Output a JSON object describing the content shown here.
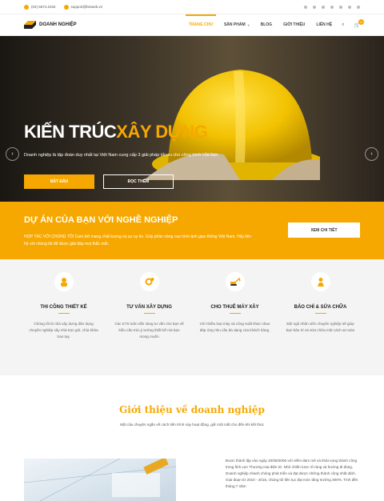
{
  "topbar": {
    "phone": "(04) 6674.2332",
    "email": "support@bizweb.vn",
    "social_icons": [
      "facebook-icon",
      "twitter-icon",
      "google-plus-icon",
      "pinterest-icon",
      "instagram-icon",
      "youtube-icon",
      "skype-icon"
    ]
  },
  "header": {
    "logo_text": "DOANH NGHIỆP",
    "nav": [
      "TRANG CHỦ",
      "SẢN PHẨM",
      "BLOG",
      "GIỚI THIỆU",
      "LIÊN HỆ"
    ],
    "active_nav": "TRANG CHỦ",
    "cart_count": "0"
  },
  "hero": {
    "title_part1": "KIẾN TRÚC",
    "title_part2": "XÂY DỰNG",
    "subtitle": "Doanh nghiệp là tập đoàn duy nhất tại Việt Nam cung cấp 3 giải pháp tối ưu cho công trình của bạn",
    "btn_primary": "BẮT ĐẦU",
    "btn_secondary": "ĐỌC THÊM"
  },
  "cta": {
    "title": "DỰ ÁN CỦA BẠN VỚI NGHỀ NGHIỆP",
    "text": "HỢP TÁC VỚI CHÚNG TÔI Cam kết mang chất lượng và sự uy tín. Góp phần nâng cao hình ảnh giao thông Việt Nam. Hãy liên hệ với chúng tôi để được giải đáp mọi thắc mắc",
    "button": "XEM CHI TIẾT"
  },
  "services": [
    {
      "icon": "construction-worker-icon",
      "title": "THI CÔNG THIẾT KẾ",
      "desc": "Chúng tôi là nhà xây dựng dân dụng chuyên nghiệp xây nhà trọn gói, chìa khóa trao tay."
    },
    {
      "icon": "gears-icon",
      "title": "TƯ VẤN XÂY DỰNG",
      "desc": "Các KTS luôn sẵn sàng tư vấn cho bạn về kiểu cấu trúc,ý tưởng thiết kế mà bạn mong muốn"
    },
    {
      "icon": "excavator-icon",
      "title": "CHO THUÊ MÁY XÂY",
      "desc": "Với nhiều loại máy và công suất khác nhau đáp ứng nhu cầu đa dạng của khách hàng."
    },
    {
      "icon": "worker-tools-icon",
      "title": "BẢO CHÌ & SỬA CHỮA",
      "desc": "Đội ngũ nhân viên chuyên nghiệp sẽ giúp bạn bảo trì và sửa chữa một cách an toàn"
    }
  ],
  "intro": {
    "title": "Giới thiệu về doanh nghiệp",
    "subtitle": "Một câu chuyện ngắn về cách tiến trình này hoạt động, giữ một mắt cho đến khi kết thúc",
    "text": "Được thành lập vào ngày 20/08/2006 với niềm đam mê và khát vọng thành công trong lĩnh vực Thương mại điện tử. Nhờ chiến lược rõ ràng và hướng đi đúng, Doanh nghiệp nhanh chóng phát triển và đạt được những thành công nhất định. Giai đoạn từ 2010 - 2015, chúng tôi liên tục đạt mức tăng trưởng 300%. Tính đến tháng 7 năm"
  },
  "colors": {
    "accent": "#f7a800",
    "dark": "#222222"
  }
}
